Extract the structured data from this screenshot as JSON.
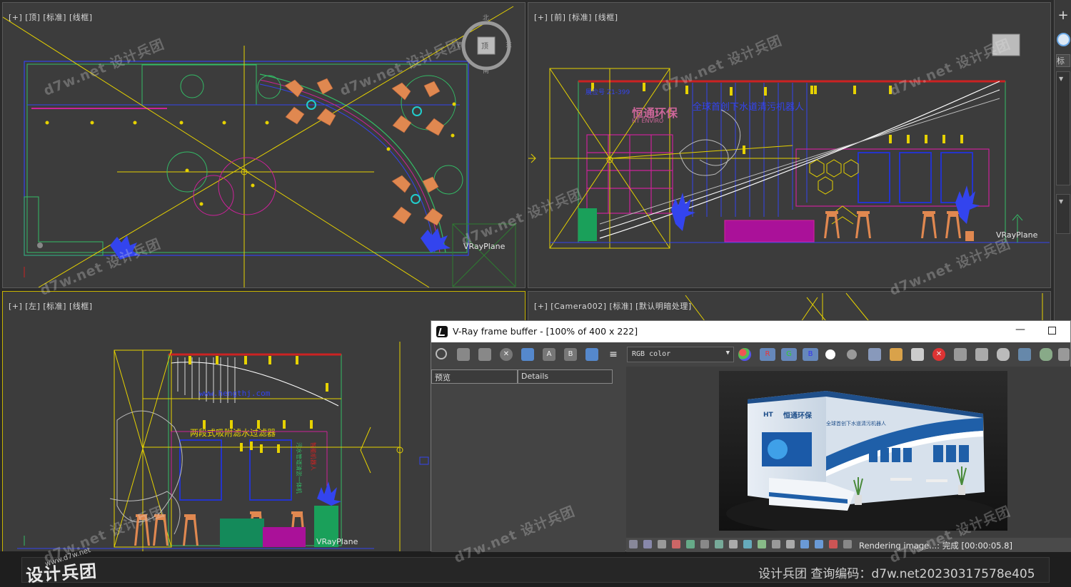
{
  "viewports": {
    "top": {
      "label": "[+] [顶] [标准] [线框]",
      "plane_label": "VRayPlane"
    },
    "front": {
      "label": "[+] [前] [标准] [线框]",
      "plane_label": "VRayPlane"
    },
    "left": {
      "label": "[+] [左] [标准] [线框]",
      "plane_label": "VRayPlane"
    },
    "camera": {
      "label": "[+] [Camera002] [标准] [默认明暗处理]"
    }
  },
  "right_panel": {
    "std_label": "标"
  },
  "vray_frame_buffer": {
    "title": "V-Ray frame buffer - [100% of 400 x 222]",
    "channel_select": "RGB color",
    "tabs": [
      {
        "label": "预览"
      },
      {
        "label": "Details"
      }
    ],
    "toolbar_letters": {
      "a": "A",
      "b": "B",
      "r": "R",
      "g": "G",
      "bb": "B"
    },
    "status_text": "Rendering image...: 完成 [00:00:05.8]"
  },
  "bottom_bar": {
    "info_text": "设计兵团  查询编码：d7w.net20230317578e405",
    "logo_big": "设计兵团",
    "logo_small": "www.d7w.net"
  },
  "watermark_text": "d7w.net 设计兵团",
  "colors": {
    "viewport_bg": "#3c3c3c",
    "active_border": "#c8b400",
    "wire_yellow": "#e6d200",
    "wire_orange": "#e08850",
    "wire_blue": "#3344ee",
    "wire_green": "#33bb66",
    "wire_magenta": "#cc2299"
  }
}
